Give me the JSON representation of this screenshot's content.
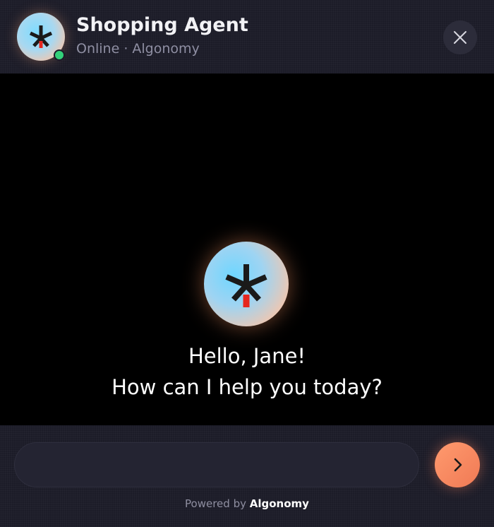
{
  "header": {
    "agent_name": "Shopping Agent",
    "agent_status": "Online · Algonomy",
    "avatar_icon": "asterisk-logo-icon",
    "close_icon": "close-icon"
  },
  "main": {
    "greeting_line1": "Hello, Jane!",
    "greeting_line2": "How can I help you today?"
  },
  "footer": {
    "input_value": "",
    "input_placeholder": "",
    "send_icon": "chevron-right-icon",
    "powered_prefix": "Powered by",
    "powered_brand": "Algonomy"
  },
  "colors": {
    "accent": "#f07a55",
    "status_online": "#33d17a",
    "background": "#1c1c28",
    "content_background": "#000000"
  }
}
